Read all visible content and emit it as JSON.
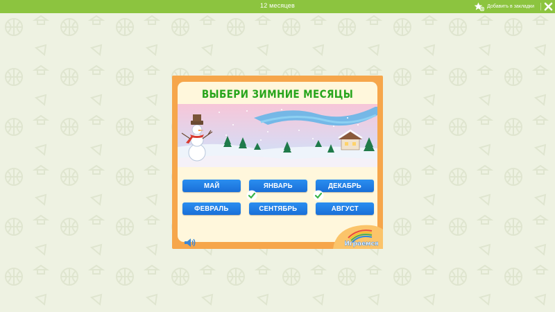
{
  "header": {
    "title": "12 месяцев",
    "bookmark_label": "Добавить в закладки",
    "icons": {
      "bookmark": "star-plus-icon",
      "close": "close-icon"
    }
  },
  "game": {
    "heading": "ВЫБЕРИ ЗИМНИЕ МЕСЯЦЫ",
    "months": [
      {
        "label": "МАЙ",
        "checked": false
      },
      {
        "label": "ЯНВАРЬ",
        "checked": true
      },
      {
        "label": "ДЕКАБРЬ",
        "checked": true
      },
      {
        "label": "ФЕВРАЛЬ",
        "checked": false
      },
      {
        "label": "СЕНТЯБРЬ",
        "checked": false
      },
      {
        "label": "АВГУСТ",
        "checked": false
      }
    ],
    "logo_text": "Играемся",
    "icons": {
      "sound": "speaker-icon",
      "check": "check-icon"
    }
  },
  "colors": {
    "topbar": "#8cc43f",
    "frame": "#f6a64b",
    "button": "#1f7fe6",
    "heading": "#27a51c",
    "check": "#3bb54a"
  }
}
